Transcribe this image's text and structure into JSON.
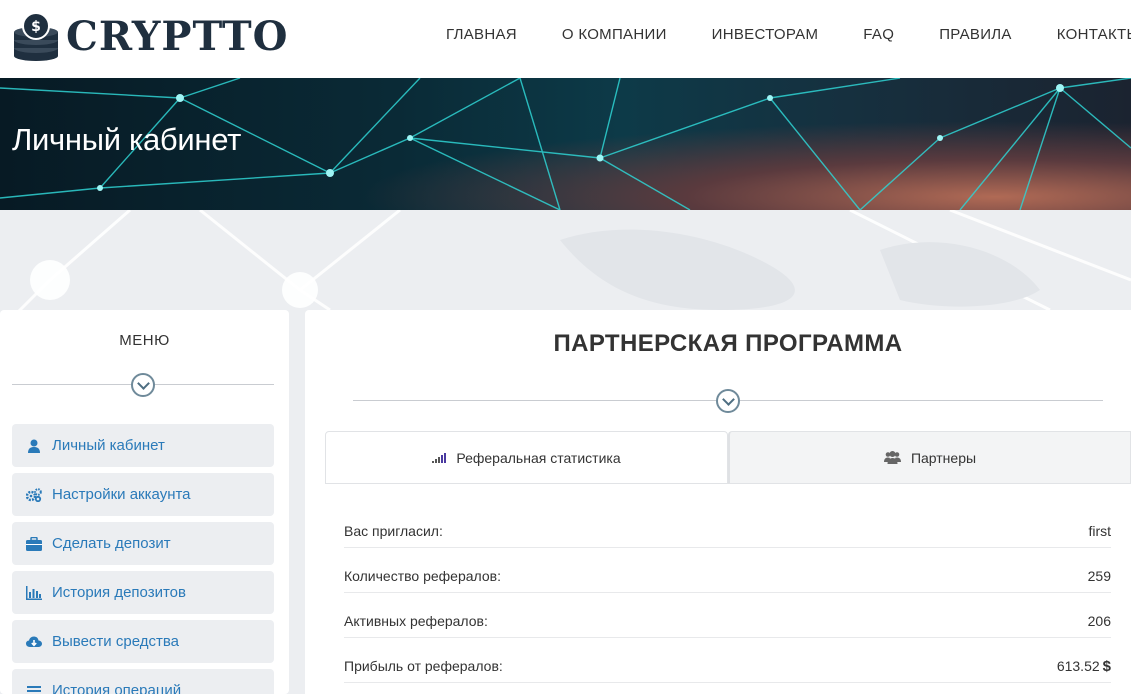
{
  "header": {
    "logo_text": "CRYPTTO",
    "nav": [
      "ГЛАВНАЯ",
      "О КОМПАНИИ",
      "ИНВЕСТОРАМ",
      "FAQ",
      "ПРАВИЛА",
      "КОНТАКТЫ"
    ]
  },
  "hero": {
    "title": "Личный кабинет"
  },
  "sidebar": {
    "title": "МЕНЮ",
    "items": [
      {
        "label": "Личный кабинет",
        "icon": "user-icon"
      },
      {
        "label": "Настройки аккаунта",
        "icon": "gears-icon"
      },
      {
        "label": "Сделать депозит",
        "icon": "briefcase-icon"
      },
      {
        "label": "История депозитов",
        "icon": "bar-chart-icon"
      },
      {
        "label": "Вывести средства",
        "icon": "cloud-download-icon"
      },
      {
        "label": "История операций",
        "icon": "list-icon"
      }
    ]
  },
  "main": {
    "title": "ПАРТНЕРСКАЯ ПРОГРАММА",
    "tabs": [
      {
        "label": "Реферальная статистика",
        "icon": "signal-icon",
        "active": true
      },
      {
        "label": "Партнеры",
        "icon": "users-icon",
        "active": false
      }
    ],
    "stats": [
      {
        "label": "Вас пригласил:",
        "value": "first"
      },
      {
        "label": "Количество рефералов:",
        "value": "259"
      },
      {
        "label": "Активных рефералов:",
        "value": "206"
      },
      {
        "label": "Прибыль от рефералов:",
        "value": "613.52",
        "currency": "$"
      }
    ]
  },
  "colors": {
    "link": "#2a7ab9",
    "hero_dark": "#0a2a36",
    "accent_cyan": "#33d6d6"
  }
}
